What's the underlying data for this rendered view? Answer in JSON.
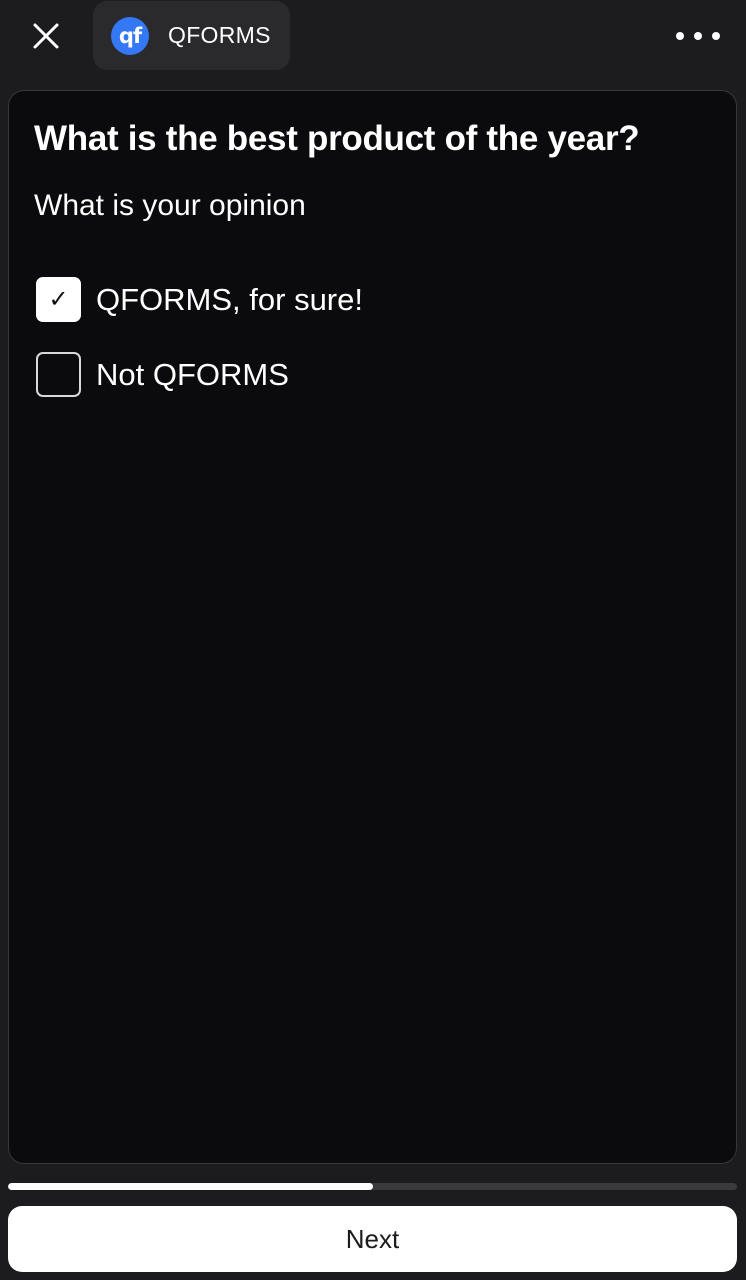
{
  "header": {
    "close_icon": "close-icon",
    "app_logo_text": "qf",
    "app_name": "QFORMS",
    "more_icon": "more-horizontal-icon",
    "accent_color": "#3478f6"
  },
  "form": {
    "question_title": "What is the best product of the year?",
    "question_subtitle": "What is your opinion",
    "options": [
      {
        "label": "QFORMS, for sure!",
        "checked": true,
        "check_glyph": "✓"
      },
      {
        "label": "Not QFORMS",
        "checked": false
      }
    ]
  },
  "progress": {
    "fraction": 0.5
  },
  "footer": {
    "next_label": "Next"
  }
}
